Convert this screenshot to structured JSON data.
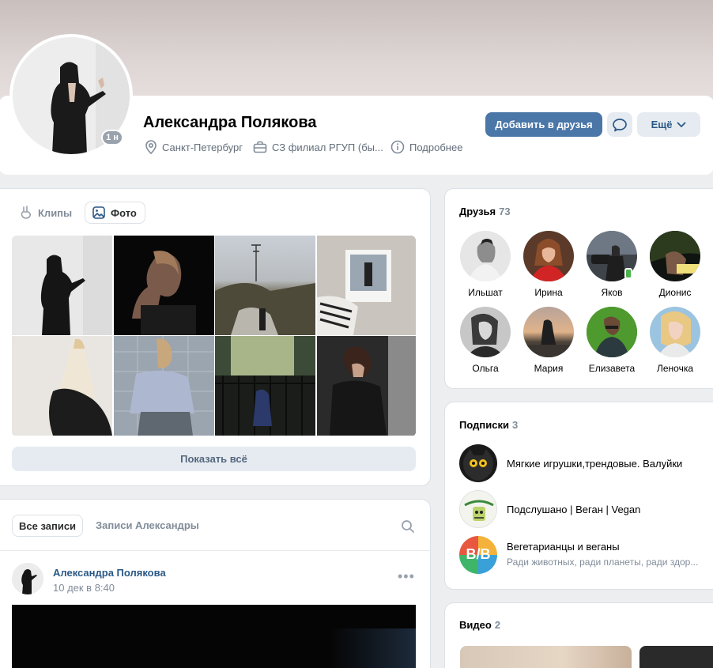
{
  "profile": {
    "name": "Александра Полякова",
    "online_badge": "1 н",
    "city": "Санкт-Петербург",
    "work": "СЗ филиал РГУП (бы...",
    "details_label": "Подробнее",
    "add_friend_label": "Добавить в друзья",
    "more_label": "Ещё"
  },
  "photos": {
    "tab_clips": "Клипы",
    "tab_photo": "Фото",
    "show_all": "Показать всё"
  },
  "wall": {
    "tab_all": "Все записи",
    "tab_own": "Записи Александры",
    "post": {
      "author": "Александра Полякова",
      "date": "10 дек в 8:40"
    }
  },
  "friends": {
    "title": "Друзья",
    "count": "73",
    "items": [
      {
        "name": "Ильшат"
      },
      {
        "name": "Ирина"
      },
      {
        "name": "Яков"
      },
      {
        "name": "Дионис"
      },
      {
        "name": "Ольга"
      },
      {
        "name": "Мария"
      },
      {
        "name": "Елизавета"
      },
      {
        "name": "Леночка"
      }
    ]
  },
  "subscriptions": {
    "title": "Подписки",
    "count": "3",
    "items": [
      {
        "name": "Мягкие игрушки,трендовые. Валуйки",
        "desc": ""
      },
      {
        "name": "Подслушано | Веган | Vegan",
        "desc": ""
      },
      {
        "name": "Вегетарианцы и веганы",
        "desc": "Ради животных, ради планеты, ради здор..."
      }
    ],
    "logo_text": "В/В"
  },
  "video": {
    "title": "Видео",
    "count": "2"
  },
  "colors": {
    "accent": "#4a76a8",
    "link": "#2a5885",
    "secondary": "#818c99",
    "online": "#4bb34b"
  }
}
